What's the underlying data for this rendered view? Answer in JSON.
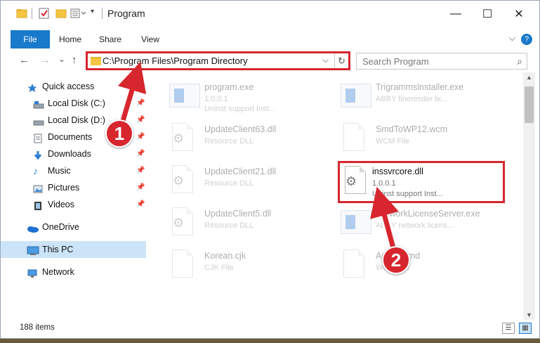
{
  "titlebar": {
    "title": "Program",
    "minimize": "—",
    "maximize": "☐",
    "close": "✕"
  },
  "ribbon": {
    "tabs": [
      "File",
      "Home",
      "Share",
      "View"
    ],
    "help": "?",
    "collapse": "⌵"
  },
  "nav": {
    "back": "←",
    "forward": "→",
    "recent": "⌄",
    "up": "↑",
    "address": "C:\\Program Files\\Program Directory",
    "address_dropdown": "⌵",
    "refresh": "↻",
    "search_placeholder": "Search Program",
    "search_icon": "⌕"
  },
  "sidebar": {
    "items": [
      {
        "label": "Quick access",
        "icon": "star-icon",
        "pinned": false
      },
      {
        "label": "Local Disk (C:)",
        "icon": "drive-icon",
        "pinned": true
      },
      {
        "label": "Local Disk (D:)",
        "icon": "drive-icon",
        "pinned": true
      },
      {
        "label": "Documents",
        "icon": "documents-icon",
        "pinned": true
      },
      {
        "label": "Downloads",
        "icon": "download-icon",
        "pinned": true
      },
      {
        "label": "Music",
        "icon": "music-icon",
        "pinned": true
      },
      {
        "label": "Pictures",
        "icon": "pictures-icon",
        "pinned": true
      },
      {
        "label": "Videos",
        "icon": "videos-icon",
        "pinned": true
      },
      {
        "label": "OneDrive",
        "icon": "cloud-icon",
        "pinned": false
      },
      {
        "label": "This PC",
        "icon": "computer-icon",
        "pinned": false,
        "selected": true
      },
      {
        "label": "Network",
        "icon": "network-icon",
        "pinned": false
      }
    ],
    "pin_glyph": "📌"
  },
  "files": [
    {
      "name": "program.exe",
      "line1": "1.0.0.1",
      "line2": "Uninst support Inst...",
      "type": "exe",
      "faded": true
    },
    {
      "name": "Trigrammslnstaller.exe",
      "line1": "ABBY fineresder bi...",
      "line2": "",
      "type": "exe",
      "faded": true
    },
    {
      "name": "UpdateClient63.dll",
      "line1": "Resource DLL",
      "line2": "",
      "type": "dll",
      "faded": true
    },
    {
      "name": "SmdToWP12.wcm",
      "line1": "WCM File",
      "line2": "",
      "type": "doc",
      "faded": true
    },
    {
      "name": "UpdateClient21.dll",
      "line1": "Resource DLL",
      "line2": "",
      "type": "dll",
      "faded": true
    },
    {
      "name": "inssvrcore.dll",
      "line1": "1.0.0.1",
      "line2": "Uninst support Inst...",
      "type": "dll",
      "faded": false,
      "highlight": true
    },
    {
      "name": "UpdateClient5.dll",
      "line1": "Resource DLL",
      "line2": "",
      "type": "dll",
      "faded": true
    },
    {
      "name": "NetworkLicenseServer.exe",
      "line1": "ABBY network licens...",
      "line2": "",
      "type": "exe",
      "faded": true
    },
    {
      "name": "Korean.cjk",
      "line1": "CJK File",
      "line2": "",
      "type": "doc",
      "faded": true
    },
    {
      "name": "Arabic.amd",
      "line1": "WCM File",
      "line2": "",
      "type": "doc",
      "faded": true
    }
  ],
  "status": {
    "count": "188 items",
    "view_details": "☰",
    "view_tiles": "▦"
  },
  "annotations": {
    "step1": "1",
    "step2": "2",
    "color": "#d7262e"
  }
}
